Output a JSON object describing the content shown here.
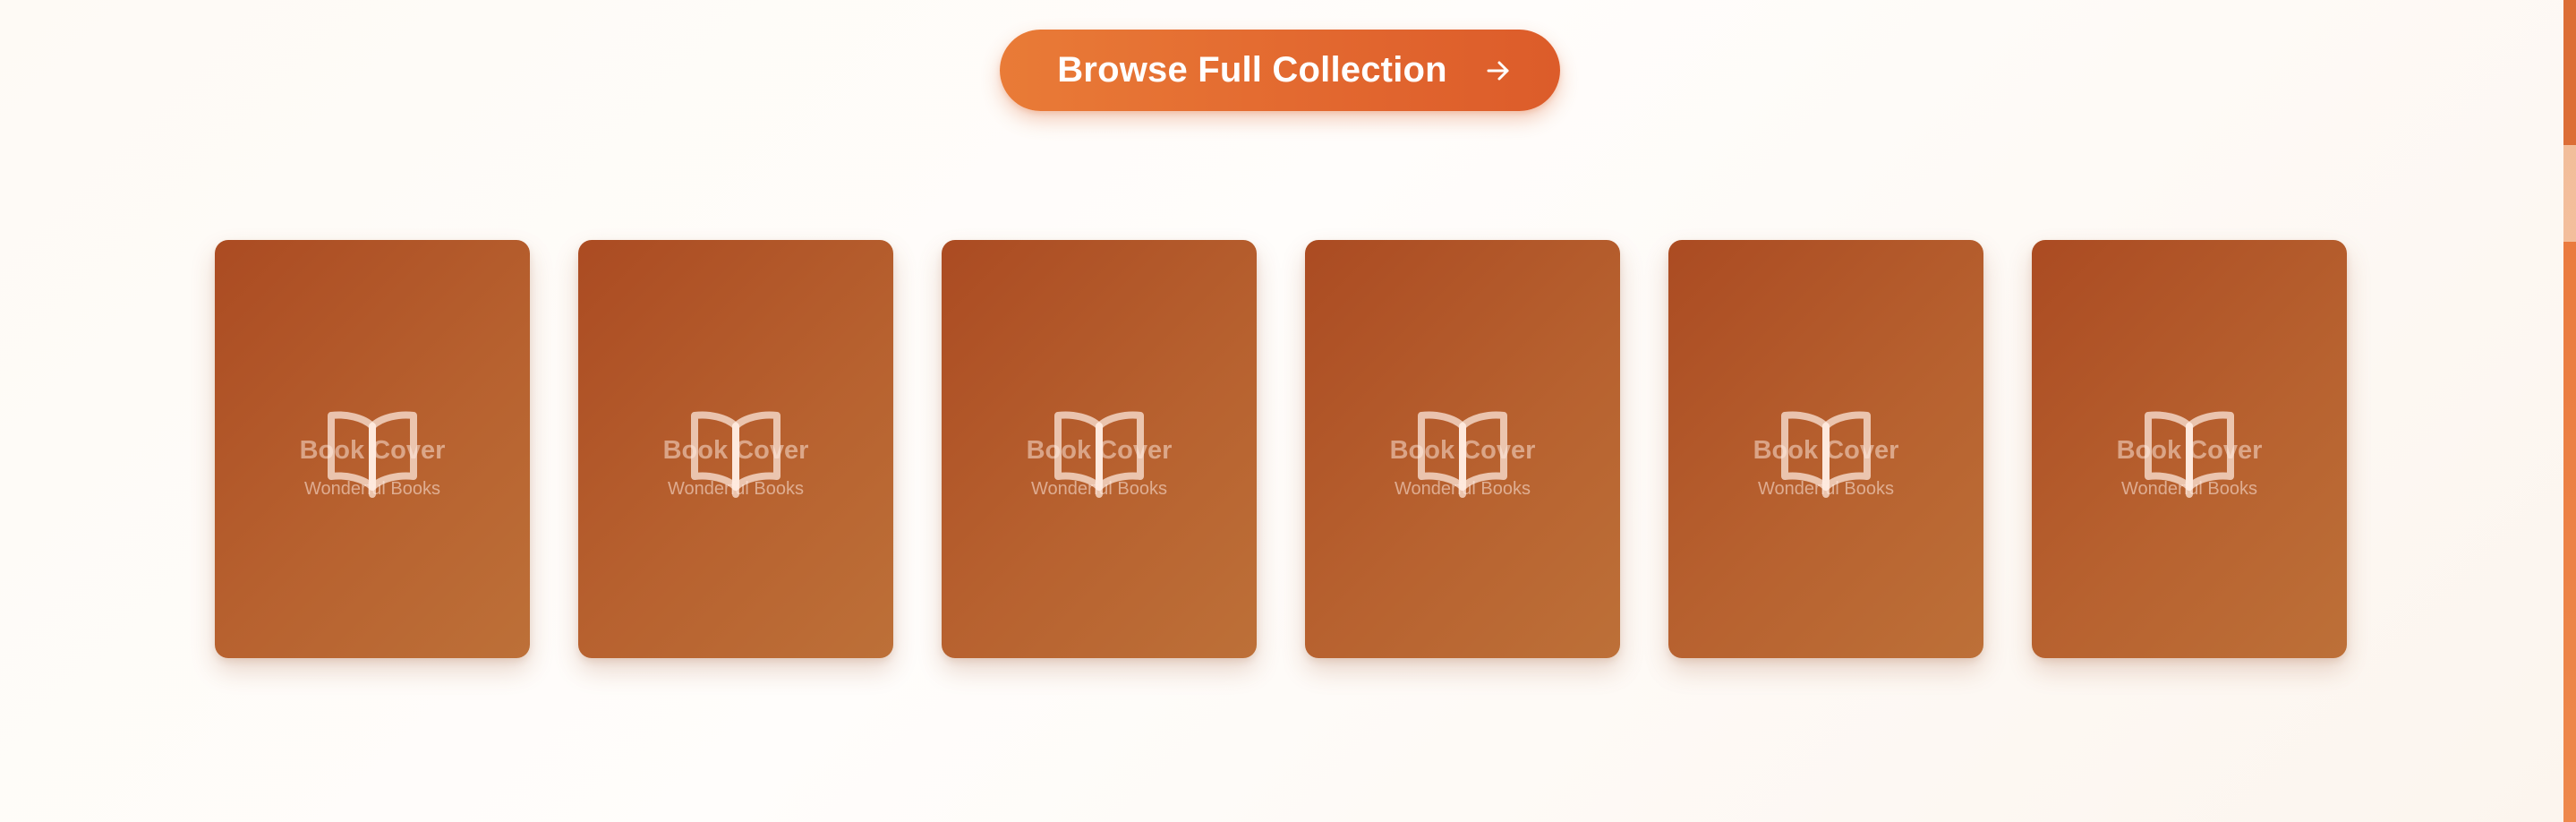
{
  "cta": {
    "label": "Browse Full Collection",
    "icon": "arrow-right-icon",
    "gradient": [
      "#e97b37",
      "#dc5c2a"
    ]
  },
  "books": [
    {
      "title": "Book Cover",
      "subtitle": "Wonderful Books",
      "icon": "open-book-icon"
    },
    {
      "title": "Book Cover",
      "subtitle": "Wonderful Books",
      "icon": "open-book-icon"
    },
    {
      "title": "Book Cover",
      "subtitle": "Wonderful Books",
      "icon": "open-book-icon"
    },
    {
      "title": "Book Cover",
      "subtitle": "Wonderful Books",
      "icon": "open-book-icon"
    },
    {
      "title": "Book Cover",
      "subtitle": "Wonderful Books",
      "icon": "open-book-icon"
    },
    {
      "title": "Book Cover",
      "subtitle": "Wonderful Books",
      "icon": "open-book-icon"
    }
  ],
  "colors": {
    "card": "#b05428",
    "accent": "#e2672f",
    "background": "#fefaf5"
  }
}
